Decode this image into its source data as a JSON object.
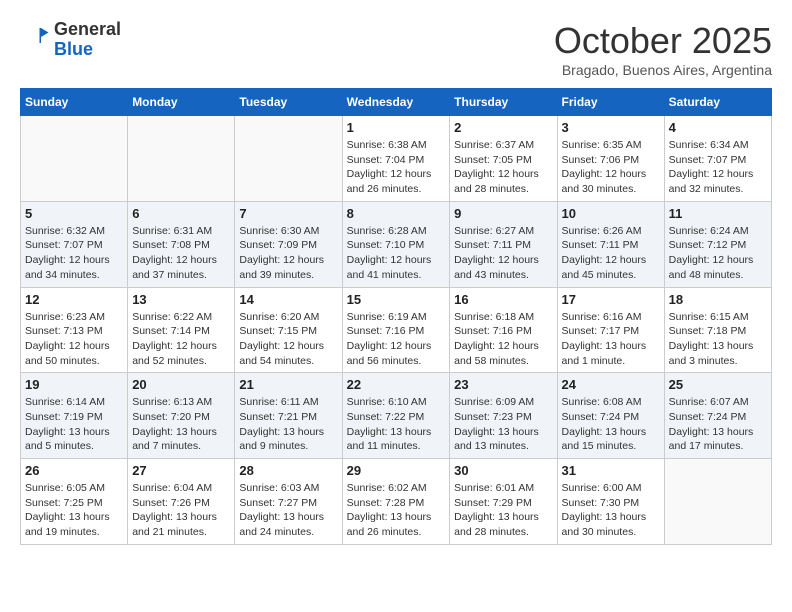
{
  "header": {
    "logo_general": "General",
    "logo_blue": "Blue",
    "month": "October 2025",
    "location": "Bragado, Buenos Aires, Argentina"
  },
  "weekdays": [
    "Sunday",
    "Monday",
    "Tuesday",
    "Wednesday",
    "Thursday",
    "Friday",
    "Saturday"
  ],
  "weeks": [
    [
      {
        "day": "",
        "info": ""
      },
      {
        "day": "",
        "info": ""
      },
      {
        "day": "",
        "info": ""
      },
      {
        "day": "1",
        "info": "Sunrise: 6:38 AM\nSunset: 7:04 PM\nDaylight: 12 hours\nand 26 minutes."
      },
      {
        "day": "2",
        "info": "Sunrise: 6:37 AM\nSunset: 7:05 PM\nDaylight: 12 hours\nand 28 minutes."
      },
      {
        "day": "3",
        "info": "Sunrise: 6:35 AM\nSunset: 7:06 PM\nDaylight: 12 hours\nand 30 minutes."
      },
      {
        "day": "4",
        "info": "Sunrise: 6:34 AM\nSunset: 7:07 PM\nDaylight: 12 hours\nand 32 minutes."
      }
    ],
    [
      {
        "day": "5",
        "info": "Sunrise: 6:32 AM\nSunset: 7:07 PM\nDaylight: 12 hours\nand 34 minutes."
      },
      {
        "day": "6",
        "info": "Sunrise: 6:31 AM\nSunset: 7:08 PM\nDaylight: 12 hours\nand 37 minutes."
      },
      {
        "day": "7",
        "info": "Sunrise: 6:30 AM\nSunset: 7:09 PM\nDaylight: 12 hours\nand 39 minutes."
      },
      {
        "day": "8",
        "info": "Sunrise: 6:28 AM\nSunset: 7:10 PM\nDaylight: 12 hours\nand 41 minutes."
      },
      {
        "day": "9",
        "info": "Sunrise: 6:27 AM\nSunset: 7:11 PM\nDaylight: 12 hours\nand 43 minutes."
      },
      {
        "day": "10",
        "info": "Sunrise: 6:26 AM\nSunset: 7:11 PM\nDaylight: 12 hours\nand 45 minutes."
      },
      {
        "day": "11",
        "info": "Sunrise: 6:24 AM\nSunset: 7:12 PM\nDaylight: 12 hours\nand 48 minutes."
      }
    ],
    [
      {
        "day": "12",
        "info": "Sunrise: 6:23 AM\nSunset: 7:13 PM\nDaylight: 12 hours\nand 50 minutes."
      },
      {
        "day": "13",
        "info": "Sunrise: 6:22 AM\nSunset: 7:14 PM\nDaylight: 12 hours\nand 52 minutes."
      },
      {
        "day": "14",
        "info": "Sunrise: 6:20 AM\nSunset: 7:15 PM\nDaylight: 12 hours\nand 54 minutes."
      },
      {
        "day": "15",
        "info": "Sunrise: 6:19 AM\nSunset: 7:16 PM\nDaylight: 12 hours\nand 56 minutes."
      },
      {
        "day": "16",
        "info": "Sunrise: 6:18 AM\nSunset: 7:16 PM\nDaylight: 12 hours\nand 58 minutes."
      },
      {
        "day": "17",
        "info": "Sunrise: 6:16 AM\nSunset: 7:17 PM\nDaylight: 13 hours\nand 1 minute."
      },
      {
        "day": "18",
        "info": "Sunrise: 6:15 AM\nSunset: 7:18 PM\nDaylight: 13 hours\nand 3 minutes."
      }
    ],
    [
      {
        "day": "19",
        "info": "Sunrise: 6:14 AM\nSunset: 7:19 PM\nDaylight: 13 hours\nand 5 minutes."
      },
      {
        "day": "20",
        "info": "Sunrise: 6:13 AM\nSunset: 7:20 PM\nDaylight: 13 hours\nand 7 minutes."
      },
      {
        "day": "21",
        "info": "Sunrise: 6:11 AM\nSunset: 7:21 PM\nDaylight: 13 hours\nand 9 minutes."
      },
      {
        "day": "22",
        "info": "Sunrise: 6:10 AM\nSunset: 7:22 PM\nDaylight: 13 hours\nand 11 minutes."
      },
      {
        "day": "23",
        "info": "Sunrise: 6:09 AM\nSunset: 7:23 PM\nDaylight: 13 hours\nand 13 minutes."
      },
      {
        "day": "24",
        "info": "Sunrise: 6:08 AM\nSunset: 7:24 PM\nDaylight: 13 hours\nand 15 minutes."
      },
      {
        "day": "25",
        "info": "Sunrise: 6:07 AM\nSunset: 7:24 PM\nDaylight: 13 hours\nand 17 minutes."
      }
    ],
    [
      {
        "day": "26",
        "info": "Sunrise: 6:05 AM\nSunset: 7:25 PM\nDaylight: 13 hours\nand 19 minutes."
      },
      {
        "day": "27",
        "info": "Sunrise: 6:04 AM\nSunset: 7:26 PM\nDaylight: 13 hours\nand 21 minutes."
      },
      {
        "day": "28",
        "info": "Sunrise: 6:03 AM\nSunset: 7:27 PM\nDaylight: 13 hours\nand 24 minutes."
      },
      {
        "day": "29",
        "info": "Sunrise: 6:02 AM\nSunset: 7:28 PM\nDaylight: 13 hours\nand 26 minutes."
      },
      {
        "day": "30",
        "info": "Sunrise: 6:01 AM\nSunset: 7:29 PM\nDaylight: 13 hours\nand 28 minutes."
      },
      {
        "day": "31",
        "info": "Sunrise: 6:00 AM\nSunset: 7:30 PM\nDaylight: 13 hours\nand 30 minutes."
      },
      {
        "day": "",
        "info": ""
      }
    ]
  ]
}
